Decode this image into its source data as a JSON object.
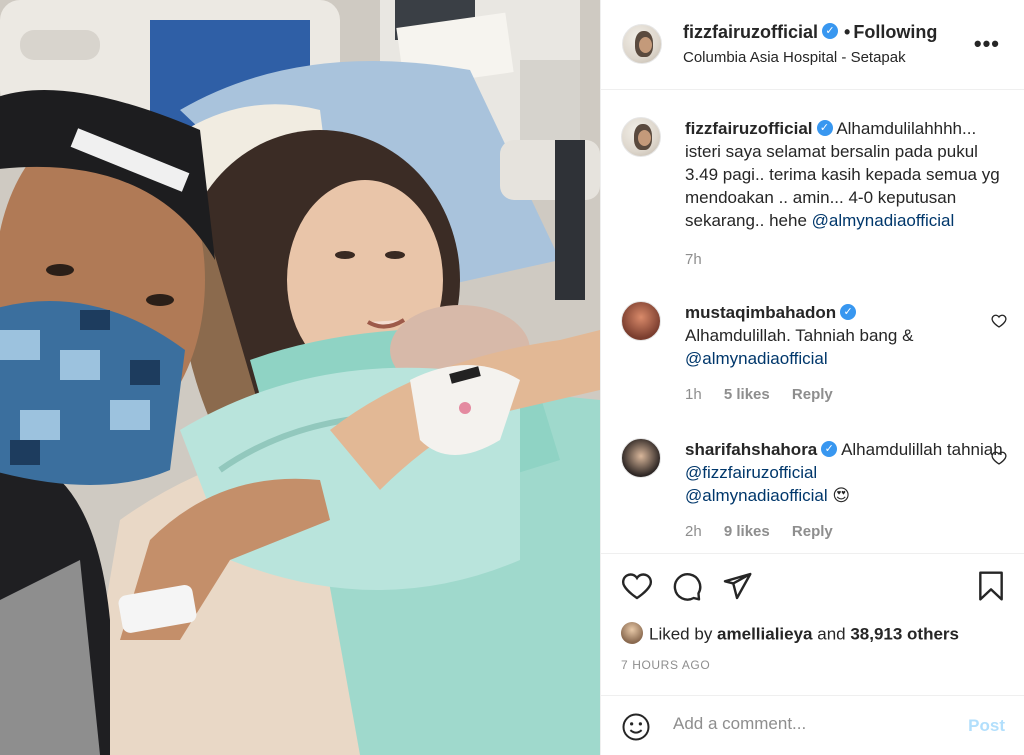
{
  "post": {
    "username": "fizzfairuzofficial",
    "verified_glyph": "✓",
    "follow_state": "Following",
    "location": "Columbia Asia Hospital - Setapak",
    "more_icon": "more-horizontal-icon",
    "photo_description_icon": "post-photo"
  },
  "caption": {
    "username": "fizzfairuzofficial",
    "text": "Alhamdulilahhhh... isteri saya selamat bersalin pada pukul 3.49 pagi.. terima kasih kepada semua yg mendoakan .. amin... 4-0 keputusan sekarang.. hehe ",
    "mention": "@almynadiaofficial",
    "time": "7h"
  },
  "comments": [
    {
      "username": "mustaqimbahadon",
      "text": "Alhamdulillah. Tahniah bang & ",
      "mention": "@almynadiaofficial",
      "time": "1h",
      "likes": "5 likes",
      "reply": "Reply"
    },
    {
      "username": "sharifahshahora",
      "text": "Alhamdulillah tahniah ",
      "mention": "@fizzfairuzofficial",
      "mention2": "@almynadiaofficial",
      "emoji": "😍",
      "time": "2h",
      "likes": "9 likes",
      "reply": "Reply"
    }
  ],
  "actions": {
    "icons": [
      "heart-icon",
      "comment-icon",
      "share-icon",
      "bookmark-icon"
    ],
    "liked_by_prefix": "Liked by ",
    "liked_by_user": "amellialieya",
    "liked_by_and": " and ",
    "liked_by_others": "38,913 others",
    "timestamp": "7 HOURS AGO"
  },
  "composer": {
    "placeholder": "Add a comment...",
    "post_label": "Post"
  },
  "colors": {
    "verified": "#3897f0",
    "mention": "#00376b",
    "post_disabled": "#b2dffc",
    "muted": "#8e8e8e"
  }
}
